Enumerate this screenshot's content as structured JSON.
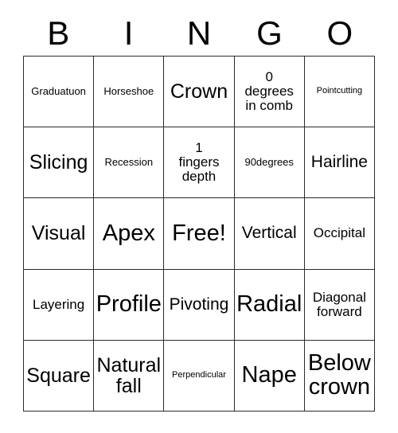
{
  "card": {
    "title": "BINGO",
    "header_letters": [
      "B",
      "I",
      "N",
      "G",
      "O"
    ],
    "free_space_label": "Free!",
    "grid_size": "5x5",
    "colors": {
      "border": "#2b2b2b",
      "text": "#000000",
      "background": "#ffffff"
    },
    "rows": [
      [
        {
          "text": "Graduatuon",
          "size": "sm"
        },
        {
          "text": "Horseshoe",
          "size": "sm"
        },
        {
          "text": "Crown",
          "size": "xl"
        },
        {
          "text": "0\ndegrees\nin comb",
          "size": "md"
        },
        {
          "text": "Pointcutting",
          "size": "xs"
        }
      ],
      [
        {
          "text": "Slicing",
          "size": "xl"
        },
        {
          "text": "Recession",
          "size": "sm"
        },
        {
          "text": "1\nfingers\ndepth",
          "size": "md"
        },
        {
          "text": "90degrees",
          "size": "sm"
        },
        {
          "text": "Hairline",
          "size": "lg"
        }
      ],
      [
        {
          "text": "Visual",
          "size": "xl"
        },
        {
          "text": "Apex",
          "size": "xxl"
        },
        {
          "text": "Free!",
          "size": "xxl"
        },
        {
          "text": "Vertical",
          "size": "lg"
        },
        {
          "text": "Occipital",
          "size": "md"
        }
      ],
      [
        {
          "text": "Layering",
          "size": "md"
        },
        {
          "text": "Profile",
          "size": "xxl"
        },
        {
          "text": "Pivoting",
          "size": "lg"
        },
        {
          "text": "Radial",
          "size": "xxl"
        },
        {
          "text": "Diagonal\nforward",
          "size": "md"
        }
      ],
      [
        {
          "text": "Square",
          "size": "xl"
        },
        {
          "text": "Natural\nfall",
          "size": "xl"
        },
        {
          "text": "Perpendicular",
          "size": "xs"
        },
        {
          "text": "Nape",
          "size": "xxl"
        },
        {
          "text": "Below\ncrown",
          "size": "xxl"
        }
      ]
    ]
  }
}
